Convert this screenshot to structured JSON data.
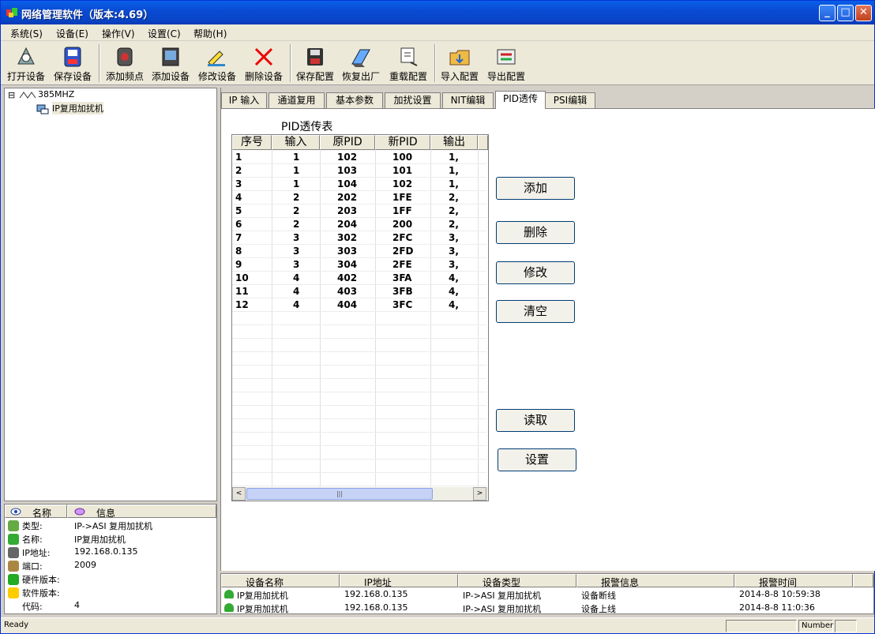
{
  "window": {
    "title": "网络管理软件（版本:4.69）"
  },
  "menu": [
    "系统(S)",
    "设备(E)",
    "操作(V)",
    "设置(C)",
    "帮助(H)"
  ],
  "toolbar": [
    {
      "label": "打开设备",
      "icon": "open-device-icon"
    },
    {
      "label": "保存设备",
      "icon": "save-device-icon"
    },
    {
      "label": "添加频点",
      "icon": "add-frequency-icon"
    },
    {
      "label": "添加设备",
      "icon": "add-device-icon"
    },
    {
      "label": "修改设备",
      "icon": "edit-device-icon"
    },
    {
      "label": "删除设备",
      "icon": "delete-icon"
    },
    {
      "label": "保存配置",
      "icon": "save-config-icon"
    },
    {
      "label": "恢复出厂",
      "icon": "factory-reset-icon"
    },
    {
      "label": "重载配置",
      "icon": "reload-config-icon"
    },
    {
      "label": "导入配置",
      "icon": "import-config-icon"
    },
    {
      "label": "导出配置",
      "icon": "export-config-icon"
    }
  ],
  "tree": {
    "root": "385MHZ",
    "child": "IP复用加扰机",
    "expander": "⊟"
  },
  "props": {
    "headers": [
      "名称",
      "信息"
    ],
    "rows": [
      {
        "label": "类型:",
        "value": "IP->ASI 复用加扰机"
      },
      {
        "label": "名称:",
        "value": "IP复用加扰机"
      },
      {
        "label": "IP地址:",
        "value": "192.168.0.135"
      },
      {
        "label": "端口:",
        "value": "2009"
      },
      {
        "label": "硬件版本:",
        "value": ""
      },
      {
        "label": "软件版本:",
        "value": ""
      },
      {
        "label": "代码:",
        "value": "4"
      }
    ]
  },
  "tabs": [
    "IP 输入",
    "通道复用",
    "基本参数",
    "加扰设置",
    "NIT编辑",
    "PID透传",
    "PSI编辑"
  ],
  "active_tab": "PID透传",
  "pid_table": {
    "title": "PID透传表",
    "columns": [
      "序号",
      "输入",
      "原PID",
      "新PID",
      "输出"
    ],
    "rows": [
      [
        "1",
        "1",
        "102",
        "100",
        "1,"
      ],
      [
        "2",
        "1",
        "103",
        "101",
        "1,"
      ],
      [
        "3",
        "1",
        "104",
        "102",
        "1,"
      ],
      [
        "4",
        "2",
        "202",
        "1FE",
        "2,"
      ],
      [
        "5",
        "2",
        "203",
        "1FF",
        "2,"
      ],
      [
        "6",
        "2",
        "204",
        "200",
        "2,"
      ],
      [
        "7",
        "3",
        "302",
        "2FC",
        "3,"
      ],
      [
        "8",
        "3",
        "303",
        "2FD",
        "3,"
      ],
      [
        "9",
        "3",
        "304",
        "2FE",
        "3,"
      ],
      [
        "10",
        "4",
        "402",
        "3FA",
        "4,"
      ],
      [
        "11",
        "4",
        "403",
        "3FB",
        "4,"
      ],
      [
        "12",
        "4",
        "404",
        "3FC",
        "4,"
      ]
    ]
  },
  "buttons": {
    "add": "添加",
    "delete": "删除",
    "modify": "修改",
    "clear": "清空",
    "read": "读取",
    "set": "设置"
  },
  "scroll": {
    "left": "<",
    "right": ">",
    "grip": "|||"
  },
  "alarms": {
    "headers": [
      "设备名称",
      "IP地址",
      "设备类型",
      "报警信息",
      "报警时间"
    ],
    "rows": [
      [
        "IP复用加扰机",
        "192.168.0.135",
        "IP->ASI 复用加扰机",
        "设备断线",
        "2014-8-8 10:59:38"
      ],
      [
        "IP复用加扰机",
        "192.168.0.135",
        "IP->ASI 复用加扰机",
        "设备上线",
        "2014-8-8 11:0:36"
      ]
    ]
  },
  "status": {
    "text": "Ready",
    "panel": "Number"
  }
}
